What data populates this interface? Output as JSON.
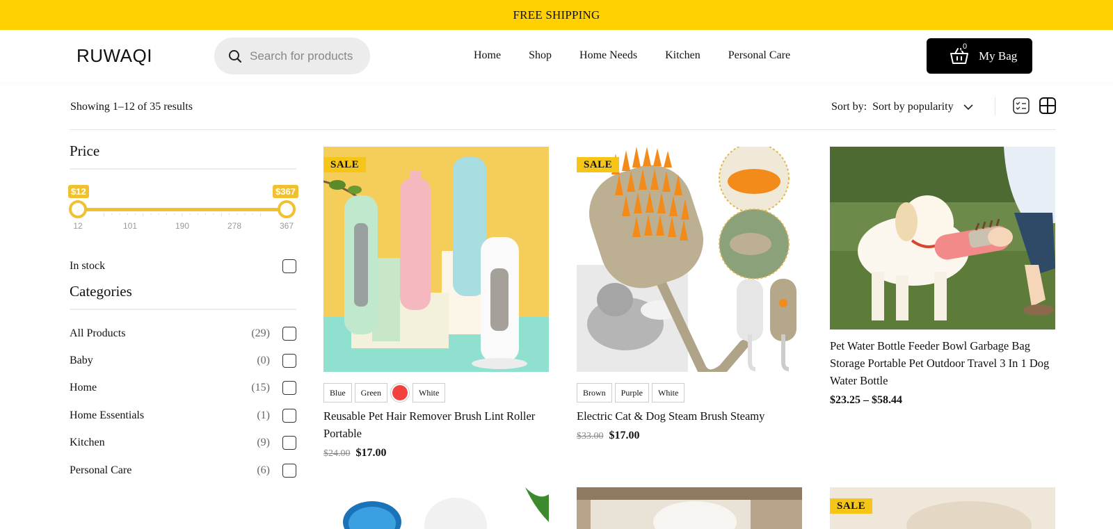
{
  "announcement": "FREE SHIPPING",
  "header": {
    "logo": "RUWAQI",
    "search_placeholder": "Search for products",
    "nav": [
      "Home",
      "Shop",
      "Home Needs",
      "Kitchen",
      "Personal Care"
    ],
    "bag_count": "0",
    "bag_label": "My Bag"
  },
  "toolbar": {
    "showing": "Showing 1–12 of 35 results",
    "sort_label": "Sort by:",
    "sort_value": "Sort by popularity"
  },
  "sidebar": {
    "price_title": "Price",
    "price_min": "$12",
    "price_max": "$367",
    "price_ticks": [
      "12",
      "101",
      "190",
      "278",
      "367"
    ],
    "in_stock_label": "In stock",
    "categories_title": "Categories",
    "categories": [
      {
        "name": "All Products",
        "count": "(29)"
      },
      {
        "name": "Baby",
        "count": "(0)"
      },
      {
        "name": "Home",
        "count": "(15)"
      },
      {
        "name": "Home Essentials",
        "count": "(1)"
      },
      {
        "name": "Kitchen",
        "count": "(9)"
      },
      {
        "name": "Personal Care",
        "count": "(6)"
      }
    ]
  },
  "products": [
    {
      "badge": "SALE",
      "swatches": [
        "Blue",
        "Green",
        "White"
      ],
      "swatch_color": "#f2413f",
      "title": "Reusable Pet Hair Remover Brush Lint Roller Portable",
      "old_price": "$24.00",
      "price": "$17.00"
    },
    {
      "badge": "SALE",
      "swatches": [
        "Brown",
        "Purple",
        "White"
      ],
      "title": "Electric Cat & Dog Steam Brush Steamy",
      "old_price": "$33.00",
      "price": "$17.00"
    },
    {
      "title": "Pet Water Bottle Feeder Bowl Garbage Bag Storage Portable Pet Outdoor Travel 3 In 1 Dog Water Bottle",
      "price": "$23.25  –  $58.44"
    }
  ],
  "row2_badge": "SALE",
  "colors": {
    "accent": "#ffd100",
    "slider": "#f0c030",
    "bag_bg": "#000000"
  }
}
